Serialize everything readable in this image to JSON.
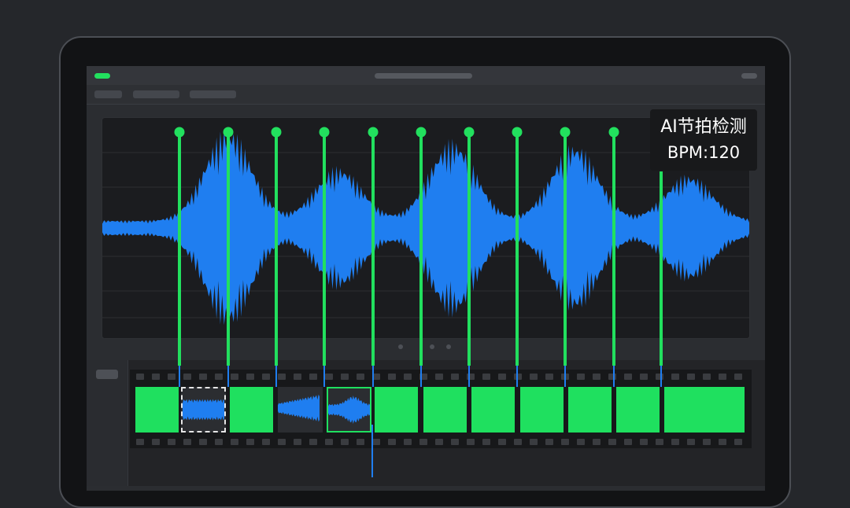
{
  "badge": {
    "line1": "AI节拍检测",
    "line2": "BPM:120"
  },
  "colors": {
    "beat": "#22e05e",
    "waveform": "#1f7ef0",
    "clip": "#1fe05f",
    "playhead": "#1f7ef0"
  },
  "beats": {
    "count": 11
  },
  "clips": [
    {
      "kind": "solid"
    },
    {
      "kind": "audio",
      "selected": "dashed"
    },
    {
      "kind": "solid"
    },
    {
      "kind": "audio"
    },
    {
      "kind": "audio",
      "selected": "green"
    },
    {
      "kind": "solid"
    },
    {
      "kind": "solid"
    },
    {
      "kind": "solid"
    },
    {
      "kind": "solid"
    },
    {
      "kind": "solid"
    },
    {
      "kind": "solid"
    },
    {
      "kind": "solid"
    }
  ],
  "pager": {
    "pages": 3,
    "current": 1
  }
}
